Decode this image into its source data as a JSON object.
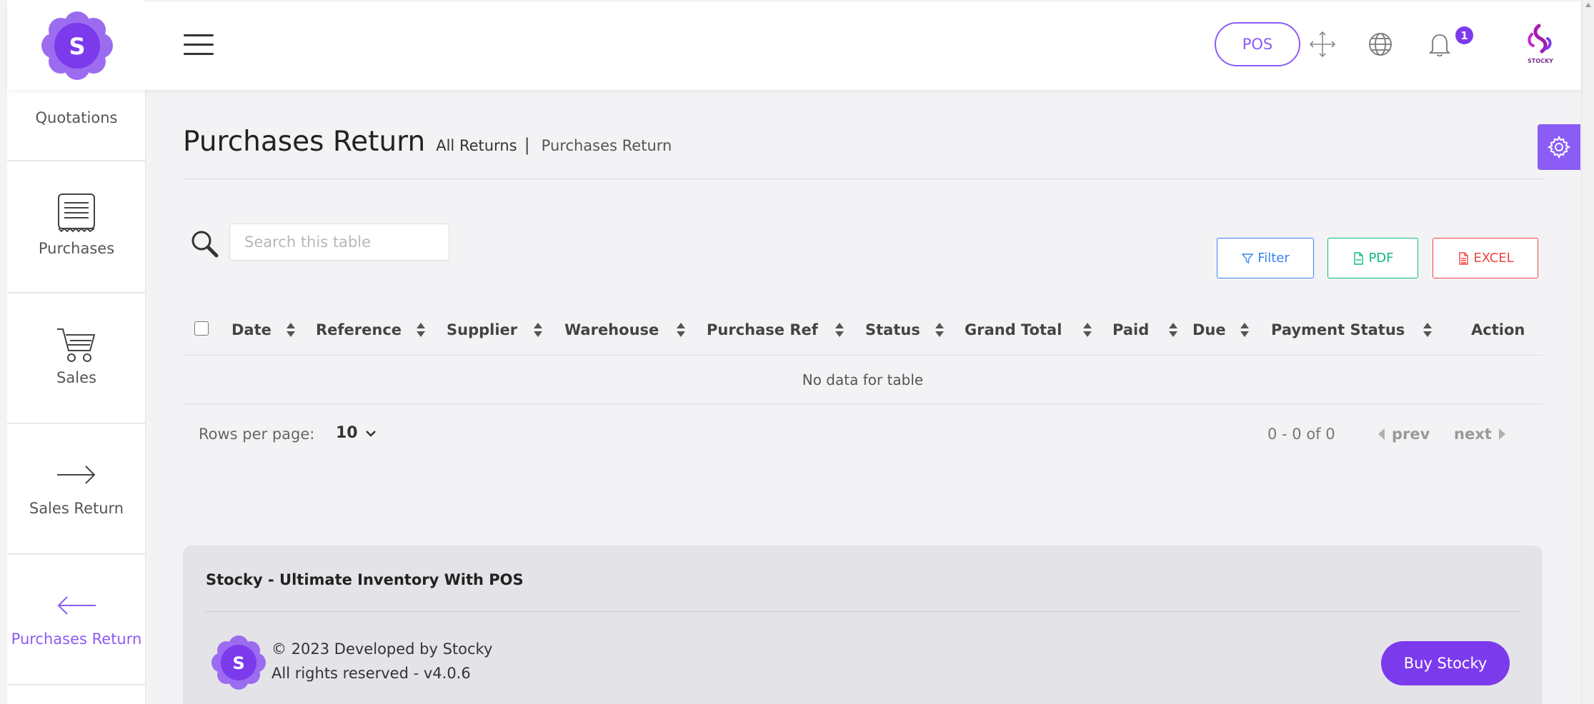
{
  "colors": {
    "accent": "#8b5cf6",
    "accent_dark": "#7c3aed",
    "filter": "#3b82f6",
    "pdf": "#10b981",
    "excel": "#ef4444"
  },
  "header": {
    "logo_letter": "S",
    "pos_label": "POS",
    "notification_count": "1",
    "brand_text": "STOCKY",
    "icons": [
      "menu-icon",
      "fullscreen-icon",
      "globe-icon",
      "bell-icon",
      "brand-logo"
    ]
  },
  "sidebar": {
    "items": [
      {
        "label": "Quotations",
        "icon": "clipboard-icon",
        "active": false
      },
      {
        "label": "Purchases",
        "icon": "receipt-icon",
        "active": false
      },
      {
        "label": "Sales",
        "icon": "cart-icon",
        "active": false
      },
      {
        "label": "Sales Return",
        "icon": "arrow-right-icon",
        "active": false
      },
      {
        "label": "Purchases Return",
        "icon": "arrow-left-icon",
        "active": true
      }
    ]
  },
  "page": {
    "title": "Purchases Return",
    "breadcrumb": [
      "All Returns",
      "|",
      "Purchases Return"
    ]
  },
  "toolbar": {
    "search_placeholder": "Search this table",
    "filter_label": "Filter",
    "pdf_label": "PDF",
    "excel_label": "EXCEL"
  },
  "table": {
    "columns": [
      "Date",
      "Reference",
      "Supplier",
      "Warehouse",
      "Purchase Ref",
      "Status",
      "Grand Total",
      "Paid",
      "Due",
      "Payment Status",
      "Action"
    ],
    "empty_text": "No data for table"
  },
  "pagination": {
    "rows_per_page_label": "Rows per page:",
    "rows_per_page": "10",
    "range_text": "0 - 0 of 0",
    "prev_label": "prev",
    "next_label": "next"
  },
  "footer": {
    "title": "Stocky - Ultimate Inventory With POS",
    "copyright": "© 2023 Developed by Stocky",
    "rights": "All rights reserved - v4.0.6",
    "buy_label": "Buy Stocky",
    "logo_letter": "S"
  }
}
